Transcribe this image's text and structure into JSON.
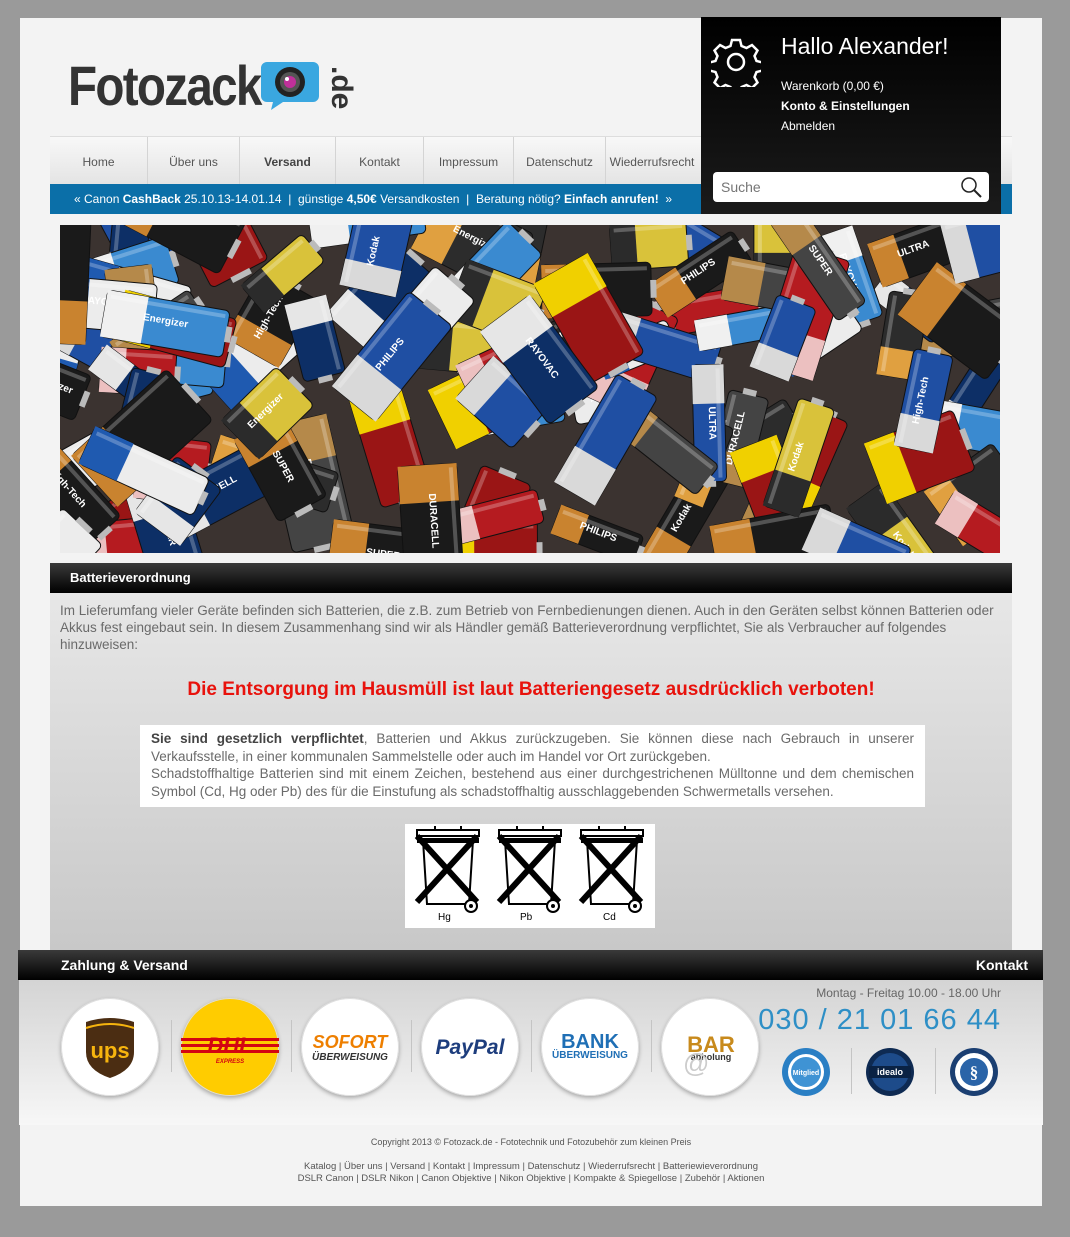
{
  "header": {
    "logo_text": "Fotozack",
    "logo_tld": ".de",
    "nav": [
      "Home",
      "Über uns",
      "Versand",
      "Kontakt",
      "Impressum",
      "Datenschutz",
      "Wiederrufsrecht"
    ],
    "active_nav": "Versand",
    "promo": {
      "prefix": "« Canon",
      "cashback": "CashBack",
      "cashback_dates": "25.10.13-14.01.14",
      "sep1": "|",
      "shipping_pre": "günstige",
      "shipping_price": "4,50€",
      "shipping_post": "Versandkosten",
      "sep2": "|",
      "advice_pre": "Beratung nötig?",
      "advice_cta": "Einfach anrufen!",
      "suffix": "»"
    }
  },
  "userbox": {
    "greeting": "Hallo Alexander!",
    "cart": "Warenkorb (0,00 €)",
    "account": "Konto & Einstellungen",
    "logout": "Abmelden",
    "search_placeholder": "Suche"
  },
  "section": {
    "title": "Batterieverordnung",
    "intro": "Im Lieferumfang vieler Geräte befinden sich Batterien, die z.B. zum Betrieb von Fernbedienungen dienen. Auch in den Geräten selbst können Batterien oder Akkus fest eingebaut sein.  In diesem Zusammenhang sind wir als Händler gemäß Batterieverordnung verpflichtet, Sie als Verbraucher auf folgendes hinzuweisen:",
    "warning": "Die Entsorgung im Hausmüll ist laut Batteriengesetz ausdrücklich verboten!",
    "notice_bold": "Sie sind gesetzlich verpflichtet",
    "notice_rest": ", Batterien und Akkus zurückzugeben. Sie können diese nach Gebrauch in unserer Verkaufsstelle, in einer kommunalen Sammelstelle oder auch im Handel vor Ort zurückgeben.",
    "notice_2": "Schadstoffhaltige Batterien sind mit einem Zeichen, bestehend aus einer durchgestrichenen Mülltonne und dem chemischen Symbol (Cd, Hg oder Pb) des für die Einstufung als schadstoffhaltig ausschlaggebenden Schwermetalls versehen.",
    "bin_labels": [
      "Hg",
      "Pb",
      "Cd"
    ]
  },
  "banner_brands": [
    "DURACELL",
    "PHILIPS",
    "Kodak",
    "SUPER",
    "RAYOVAC",
    "High-Tech",
    "Energizer",
    "ULTRA"
  ],
  "footer": {
    "left_title": "Zahlung & Versand",
    "right_title": "Kontakt",
    "payments": {
      "ups": "ups",
      "dhl": "DHL",
      "dhl_sub": "EXPRESS",
      "sofort": "SOFORT",
      "sofort_sub": "ÜBERWEISUNG",
      "paypal": "PayPal",
      "bank": "BANK",
      "bank_sub": "ÜBERWEISUNG",
      "bar": "BAR",
      "bar_sub": "abholung",
      "bar_at": "@"
    },
    "hours": "Montag - Freitag 10.00 - 18.00 Uhr",
    "phone": "030 / 21 01 66 44",
    "seals": {
      "haendlerbund": "Mitglied",
      "idealo": "idealo",
      "haendlerbund_label": "HÄNDLERBUND",
      "idealo_top": "GELISTETER",
      "idealo_bottom": "PARTNER",
      "guetesiegel": "HÄNDLERBUND GEPRÜFTE AGB"
    },
    "copyright": "Copyright 2013 © Fotozack.de - Fototechnik und Fotozubehör zum kleinen Preis",
    "links_1": "Katalog | Über uns | Versand | Kontakt | Impressum | Datenschutz | Wiederrufsrecht | Batteriewieverordnung",
    "links_2": "DSLR Canon | DSLR Nikon | Canon Objektive | Nikon Objektive | Kompakte & Spiegellose | Zubehör | Aktionen"
  },
  "colors": {
    "accent_blue": "#0b6fa8",
    "warning_red": "#e8120c",
    "phone_blue": "#2e8fc6"
  }
}
